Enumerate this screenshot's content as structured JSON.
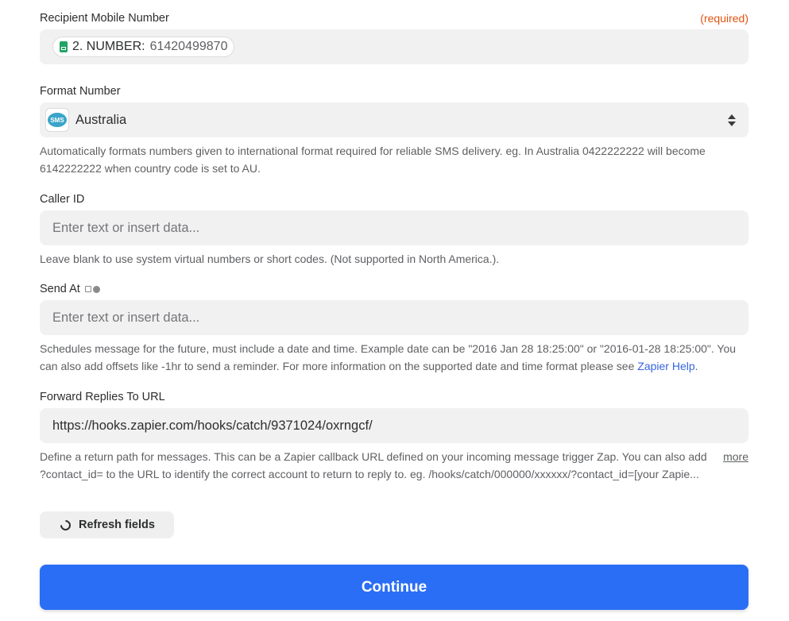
{
  "recipient": {
    "label": "Recipient Mobile Number",
    "required": "(required)",
    "pill_key": "2. NUMBER:",
    "pill_value": "61420499870",
    "pill_icon": "google-sheets-icon"
  },
  "format_number": {
    "label": "Format Number",
    "value": "Australia",
    "icon": "sms-app-icon",
    "icon_text": "SMS",
    "help": "Automatically formats numbers given to international format required for reliable SMS delivery. eg. In Australia 0422222222 will become 6142222222 when country code is set to AU."
  },
  "caller_id": {
    "label": "Caller ID",
    "placeholder": "Enter text or insert data...",
    "help": "Leave blank to use system virtual numbers or short codes. (Not supported in North America.)."
  },
  "send_at": {
    "label": "Send At",
    "placeholder": "Enter text or insert data...",
    "help_prefix": "Schedules message for the future, must include a date and time. Example date can be \"2016 Jan 28 18:25:00\" or \"2016-01-28 18:25:00\". You can also add offsets like -1hr to send a reminder. For more information on the supported date and time format please see ",
    "help_link": "Zapier Help",
    "help_suffix": "."
  },
  "forward_url": {
    "label": "Forward Replies To URL",
    "value": "https://hooks.zapier.com/hooks/catch/9371024/oxrngcf/",
    "help_line1": "Define a return path for messages. This can be a Zapier callback URL defined on your incoming message trigger Zap. You can also add",
    "help_line2": "?contact_id= to the URL to identify the correct account to return to reply to. eg. /hooks/catch/000000/xxxxxx/?contact_id=[your Zapie...",
    "more": "more"
  },
  "refresh_button": "Refresh fields",
  "continue_button": "Continue",
  "colors": {
    "accent": "#2a6ef5",
    "required": "#e0530f",
    "link": "#3565e0",
    "field_bg": "#f1f1f1"
  }
}
